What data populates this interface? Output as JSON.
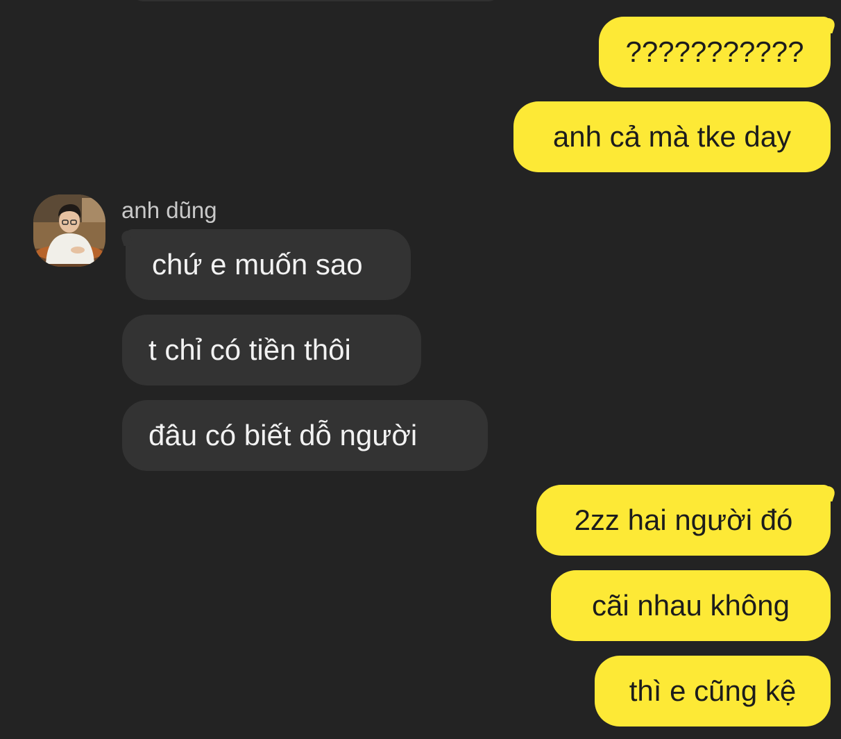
{
  "colors": {
    "background": "#232323",
    "outgoing_bubble": "#fde936",
    "incoming_bubble": "#333333",
    "outgoing_text": "#1c1c1c",
    "incoming_text": "#f2f2f2",
    "sender_name": "#c9c9c9"
  },
  "contact": {
    "name": "anh dũng",
    "avatar_icon": "profile-photo"
  },
  "messages": [
    {
      "direction": "out",
      "text": "???????????"
    },
    {
      "direction": "out",
      "text": "anh cả mà tke day"
    },
    {
      "direction": "in",
      "text": "chứ e muốn sao"
    },
    {
      "direction": "in",
      "text": "t chỉ có tiền thôi"
    },
    {
      "direction": "in",
      "text": "đâu có biết dỗ người"
    },
    {
      "direction": "out",
      "text": "2zz hai người đó"
    },
    {
      "direction": "out",
      "text": "cãi nhau không"
    },
    {
      "direction": "out",
      "text": "thì e cũng kệ"
    }
  ]
}
